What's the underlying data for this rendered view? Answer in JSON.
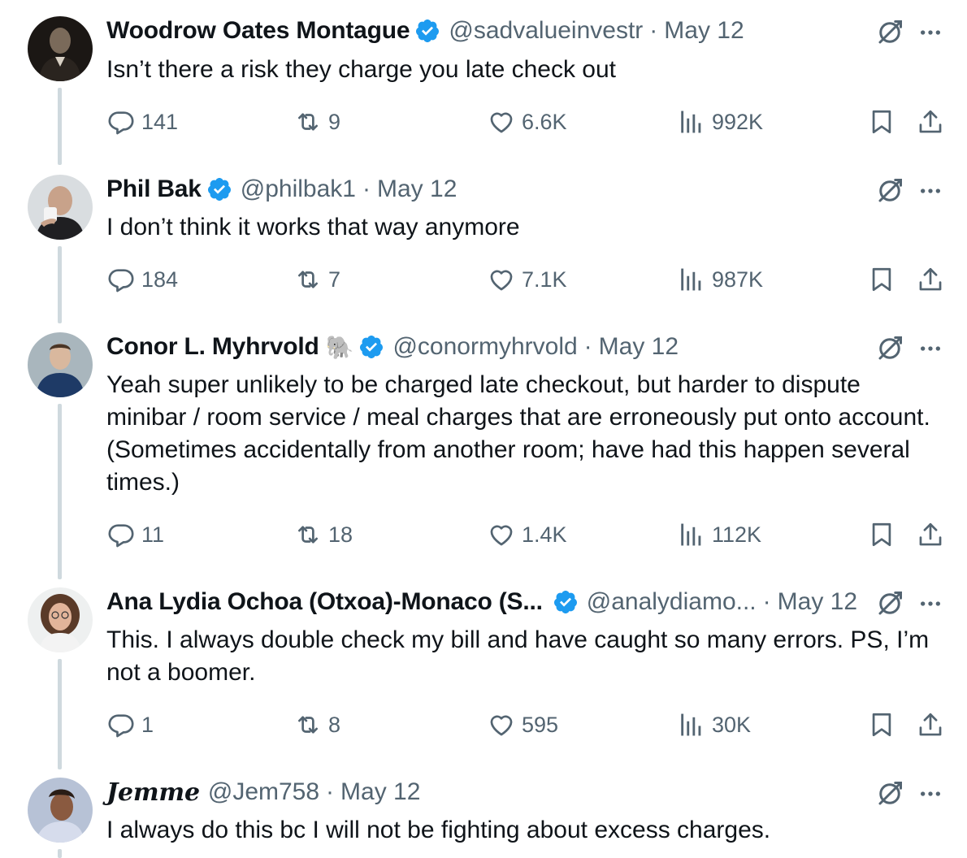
{
  "tweets": [
    {
      "name": "Woodrow Oates Montague",
      "verified": true,
      "emoji": "",
      "handle": "@sadvalueinvestr",
      "dot": "·",
      "date": "May 12",
      "text": "Isn’t there a risk they charge you late check out",
      "replies": "141",
      "reposts": "9",
      "likes": "6.6K",
      "views": "992K"
    },
    {
      "name": "Phil Bak",
      "verified": true,
      "emoji": "",
      "handle": "@philbak1",
      "dot": "·",
      "date": "May 12",
      "text": "I don’t think it works that way anymore",
      "replies": "184",
      "reposts": "7",
      "likes": "7.1K",
      "views": "987K"
    },
    {
      "name": "Conor L. Myhrvold",
      "verified": true,
      "emoji": "🐘",
      "handle": "@conormyhrvold",
      "dot": "·",
      "date": "May 12",
      "text": "Yeah super unlikely to be charged late checkout, but harder to dispute minibar / room service / meal charges that are erroneously put onto account. (Sometimes accidentally from another room; have had this happen several times.)",
      "replies": "11",
      "reposts": "18",
      "likes": "1.4K",
      "views": "112K"
    },
    {
      "name": "Ana Lydia Ochoa (Otxoa)-Monaco (S...",
      "verified": true,
      "emoji": "",
      "handle": "@analydiamo...",
      "dot": "·",
      "date": "May 12",
      "text": "This. I always double check my bill and have caught so many errors. PS, I’m not a boomer.",
      "replies": "1",
      "reposts": "8",
      "likes": "595",
      "views": "30K"
    },
    {
      "name": "𝑱𝒆𝒎𝒎𝒆",
      "verified": false,
      "emoji": "",
      "handle": "@Jem758",
      "dot": "·",
      "date": "May 12",
      "text": "I always do this bc I will not be fighting about excess charges."
    }
  ],
  "icons": {
    "verified": "verified-badge-icon",
    "grok": "grok-icon",
    "more": "more-options-icon",
    "reply": "reply-icon",
    "repost": "repost-icon",
    "like": "like-icon",
    "views": "views-icon",
    "bookmark": "bookmark-icon",
    "share": "share-icon"
  },
  "colors": {
    "text": "#0f1419",
    "secondary": "#536471",
    "verified": "#1d9bf0",
    "thread_line": "#cfd9de"
  }
}
